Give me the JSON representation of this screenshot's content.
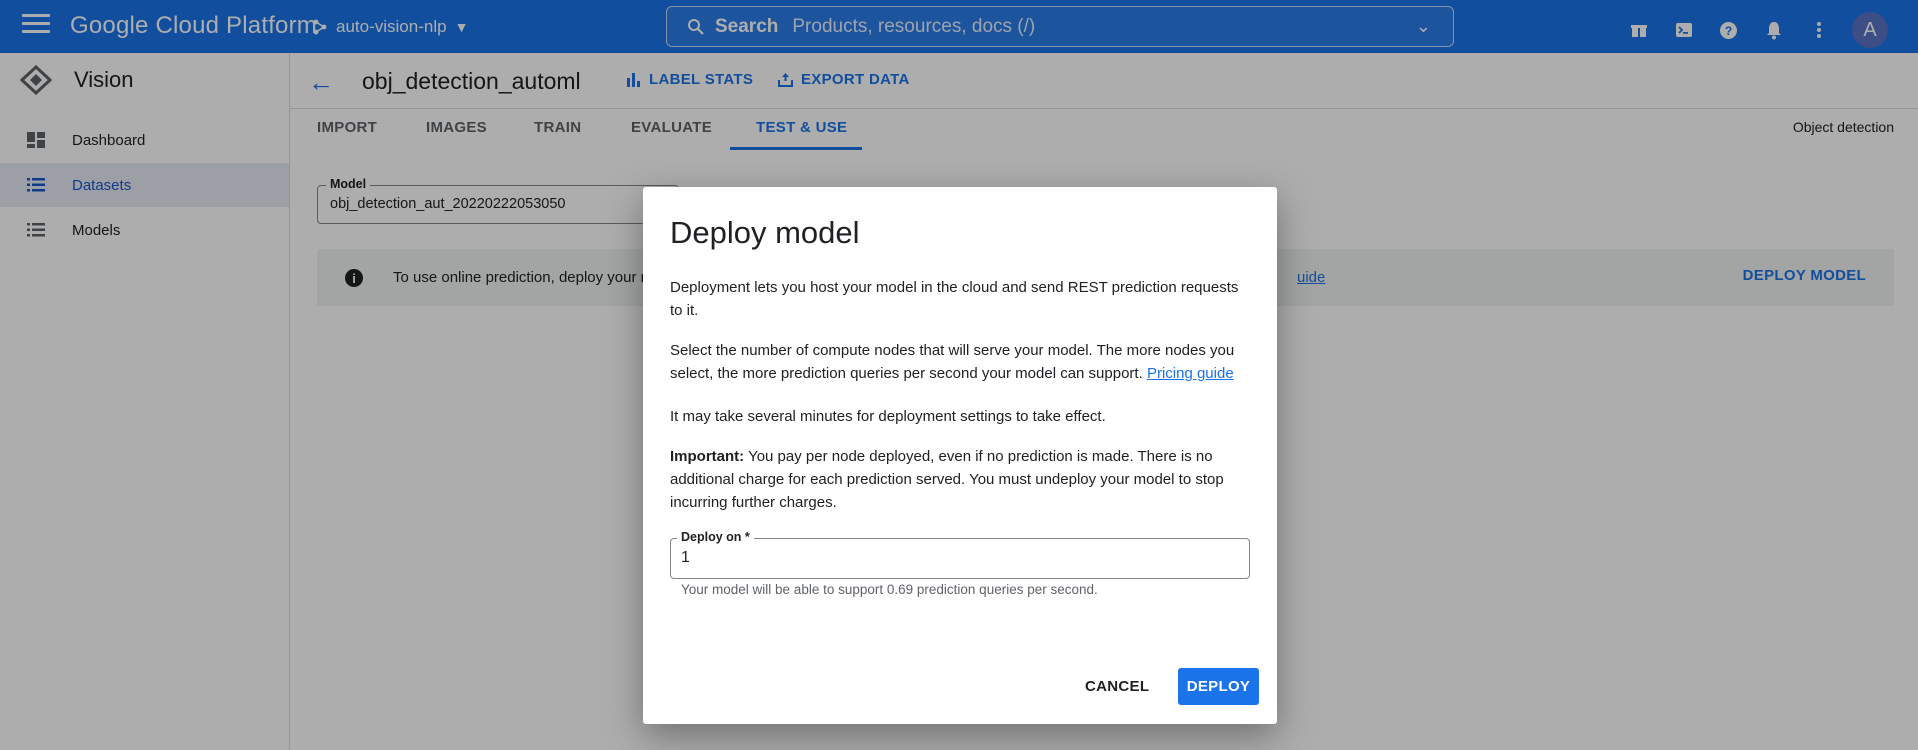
{
  "topbar": {
    "brand": "Google Cloud Platform",
    "project": "auto-vision-nlp",
    "search_label": "Search",
    "search_placeholder": "Products, resources, docs (/)",
    "avatar_letter": "A"
  },
  "sidebar": {
    "product": "Vision",
    "items": [
      {
        "label": "Dashboard"
      },
      {
        "label": "Datasets"
      },
      {
        "label": "Models"
      }
    ]
  },
  "header": {
    "title": "obj_detection_automl",
    "label_stats": "LABEL STATS",
    "export_data": "EXPORT DATA"
  },
  "tabs": [
    "IMPORT",
    "IMAGES",
    "TRAIN",
    "EVALUATE",
    "TEST & USE"
  ],
  "dataset_type": "Object detection",
  "model_field": {
    "label": "Model",
    "value": "obj_detection_aut_20220222053050"
  },
  "info_bar": {
    "text": "To use online prediction, deploy your m",
    "link_fragment": "uide",
    "deploy_button": "DEPLOY MODEL"
  },
  "dialog": {
    "title": "Deploy model",
    "p1": "Deployment lets you host your model in the cloud and send REST prediction requests to it.",
    "p2": "Select the number of compute nodes that will serve your model. The more nodes you select, the more prediction queries per second your model can support.",
    "p2_link": "Pricing guide",
    "p3": "It may take several minutes for deployment settings to take effect.",
    "p4_bold": "Important:",
    "p4": "You pay per node deployed, even if no prediction is made. There is no additional charge for each prediction served. You must undeploy your model to stop incurring further charges.",
    "field_label": "Deploy on *",
    "field_value": "1",
    "hint": "Your model will be able to support 0.69 prediction queries per second.",
    "cancel": "CANCEL",
    "deploy": "DEPLOY"
  },
  "colors": {
    "accent": "#1a73e8",
    "topbar": "#1a73e8",
    "scrim": "rgba(0,0,0,0.32)"
  }
}
